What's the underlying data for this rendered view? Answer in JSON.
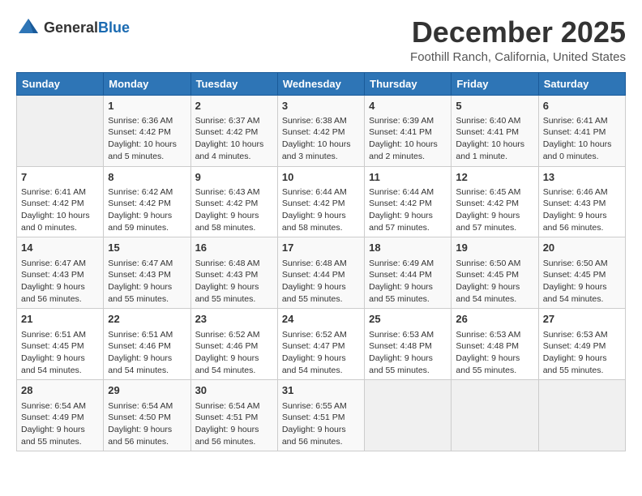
{
  "logo": {
    "general": "General",
    "blue": "Blue"
  },
  "title": "December 2025",
  "subtitle": "Foothill Ranch, California, United States",
  "calendar": {
    "headers": [
      "Sunday",
      "Monday",
      "Tuesday",
      "Wednesday",
      "Thursday",
      "Friday",
      "Saturday"
    ],
    "weeks": [
      [
        {
          "day": "",
          "content": ""
        },
        {
          "day": "1",
          "content": "Sunrise: 6:36 AM\nSunset: 4:42 PM\nDaylight: 10 hours\nand 5 minutes."
        },
        {
          "day": "2",
          "content": "Sunrise: 6:37 AM\nSunset: 4:42 PM\nDaylight: 10 hours\nand 4 minutes."
        },
        {
          "day": "3",
          "content": "Sunrise: 6:38 AM\nSunset: 4:42 PM\nDaylight: 10 hours\nand 3 minutes."
        },
        {
          "day": "4",
          "content": "Sunrise: 6:39 AM\nSunset: 4:41 PM\nDaylight: 10 hours\nand 2 minutes."
        },
        {
          "day": "5",
          "content": "Sunrise: 6:40 AM\nSunset: 4:41 PM\nDaylight: 10 hours\nand 1 minute."
        },
        {
          "day": "6",
          "content": "Sunrise: 6:41 AM\nSunset: 4:41 PM\nDaylight: 10 hours\nand 0 minutes."
        }
      ],
      [
        {
          "day": "7",
          "content": "Sunrise: 6:41 AM\nSunset: 4:42 PM\nDaylight: 10 hours\nand 0 minutes."
        },
        {
          "day": "8",
          "content": "Sunrise: 6:42 AM\nSunset: 4:42 PM\nDaylight: 9 hours\nand 59 minutes."
        },
        {
          "day": "9",
          "content": "Sunrise: 6:43 AM\nSunset: 4:42 PM\nDaylight: 9 hours\nand 58 minutes."
        },
        {
          "day": "10",
          "content": "Sunrise: 6:44 AM\nSunset: 4:42 PM\nDaylight: 9 hours\nand 58 minutes."
        },
        {
          "day": "11",
          "content": "Sunrise: 6:44 AM\nSunset: 4:42 PM\nDaylight: 9 hours\nand 57 minutes."
        },
        {
          "day": "12",
          "content": "Sunrise: 6:45 AM\nSunset: 4:42 PM\nDaylight: 9 hours\nand 57 minutes."
        },
        {
          "day": "13",
          "content": "Sunrise: 6:46 AM\nSunset: 4:43 PM\nDaylight: 9 hours\nand 56 minutes."
        }
      ],
      [
        {
          "day": "14",
          "content": "Sunrise: 6:47 AM\nSunset: 4:43 PM\nDaylight: 9 hours\nand 56 minutes."
        },
        {
          "day": "15",
          "content": "Sunrise: 6:47 AM\nSunset: 4:43 PM\nDaylight: 9 hours\nand 55 minutes."
        },
        {
          "day": "16",
          "content": "Sunrise: 6:48 AM\nSunset: 4:43 PM\nDaylight: 9 hours\nand 55 minutes."
        },
        {
          "day": "17",
          "content": "Sunrise: 6:48 AM\nSunset: 4:44 PM\nDaylight: 9 hours\nand 55 minutes."
        },
        {
          "day": "18",
          "content": "Sunrise: 6:49 AM\nSunset: 4:44 PM\nDaylight: 9 hours\nand 55 minutes."
        },
        {
          "day": "19",
          "content": "Sunrise: 6:50 AM\nSunset: 4:45 PM\nDaylight: 9 hours\nand 54 minutes."
        },
        {
          "day": "20",
          "content": "Sunrise: 6:50 AM\nSunset: 4:45 PM\nDaylight: 9 hours\nand 54 minutes."
        }
      ],
      [
        {
          "day": "21",
          "content": "Sunrise: 6:51 AM\nSunset: 4:45 PM\nDaylight: 9 hours\nand 54 minutes."
        },
        {
          "day": "22",
          "content": "Sunrise: 6:51 AM\nSunset: 4:46 PM\nDaylight: 9 hours\nand 54 minutes."
        },
        {
          "day": "23",
          "content": "Sunrise: 6:52 AM\nSunset: 4:46 PM\nDaylight: 9 hours\nand 54 minutes."
        },
        {
          "day": "24",
          "content": "Sunrise: 6:52 AM\nSunset: 4:47 PM\nDaylight: 9 hours\nand 54 minutes."
        },
        {
          "day": "25",
          "content": "Sunrise: 6:53 AM\nSunset: 4:48 PM\nDaylight: 9 hours\nand 55 minutes."
        },
        {
          "day": "26",
          "content": "Sunrise: 6:53 AM\nSunset: 4:48 PM\nDaylight: 9 hours\nand 55 minutes."
        },
        {
          "day": "27",
          "content": "Sunrise: 6:53 AM\nSunset: 4:49 PM\nDaylight: 9 hours\nand 55 minutes."
        }
      ],
      [
        {
          "day": "28",
          "content": "Sunrise: 6:54 AM\nSunset: 4:49 PM\nDaylight: 9 hours\nand 55 minutes."
        },
        {
          "day": "29",
          "content": "Sunrise: 6:54 AM\nSunset: 4:50 PM\nDaylight: 9 hours\nand 56 minutes."
        },
        {
          "day": "30",
          "content": "Sunrise: 6:54 AM\nSunset: 4:51 PM\nDaylight: 9 hours\nand 56 minutes."
        },
        {
          "day": "31",
          "content": "Sunrise: 6:55 AM\nSunset: 4:51 PM\nDaylight: 9 hours\nand 56 minutes."
        },
        {
          "day": "",
          "content": ""
        },
        {
          "day": "",
          "content": ""
        },
        {
          "day": "",
          "content": ""
        }
      ]
    ]
  }
}
